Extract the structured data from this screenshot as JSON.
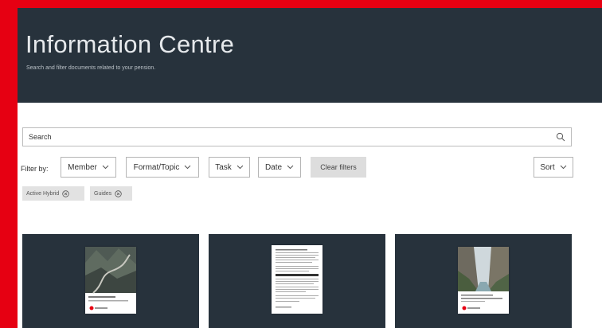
{
  "header": {
    "title": "Information Centre",
    "subtitle": "Search and filter documents related to your pension."
  },
  "search": {
    "placeholder": "Search"
  },
  "filters": {
    "label": "Filter by:",
    "dropdowns": [
      "Member",
      "Format/Topic",
      "Task",
      "Date"
    ],
    "clear_label": "Clear filters",
    "sort_label": "Sort"
  },
  "active_tags": [
    "Active Hybrid",
    "Guides"
  ],
  "colors": {
    "brand_red": "#e60012",
    "hero_bg": "#27323c",
    "card_bg": "#27323c"
  },
  "cards": [
    {
      "thumb": "mountain-road-guide"
    },
    {
      "thumb": "text-document"
    },
    {
      "thumb": "cliff-river-guide"
    }
  ]
}
